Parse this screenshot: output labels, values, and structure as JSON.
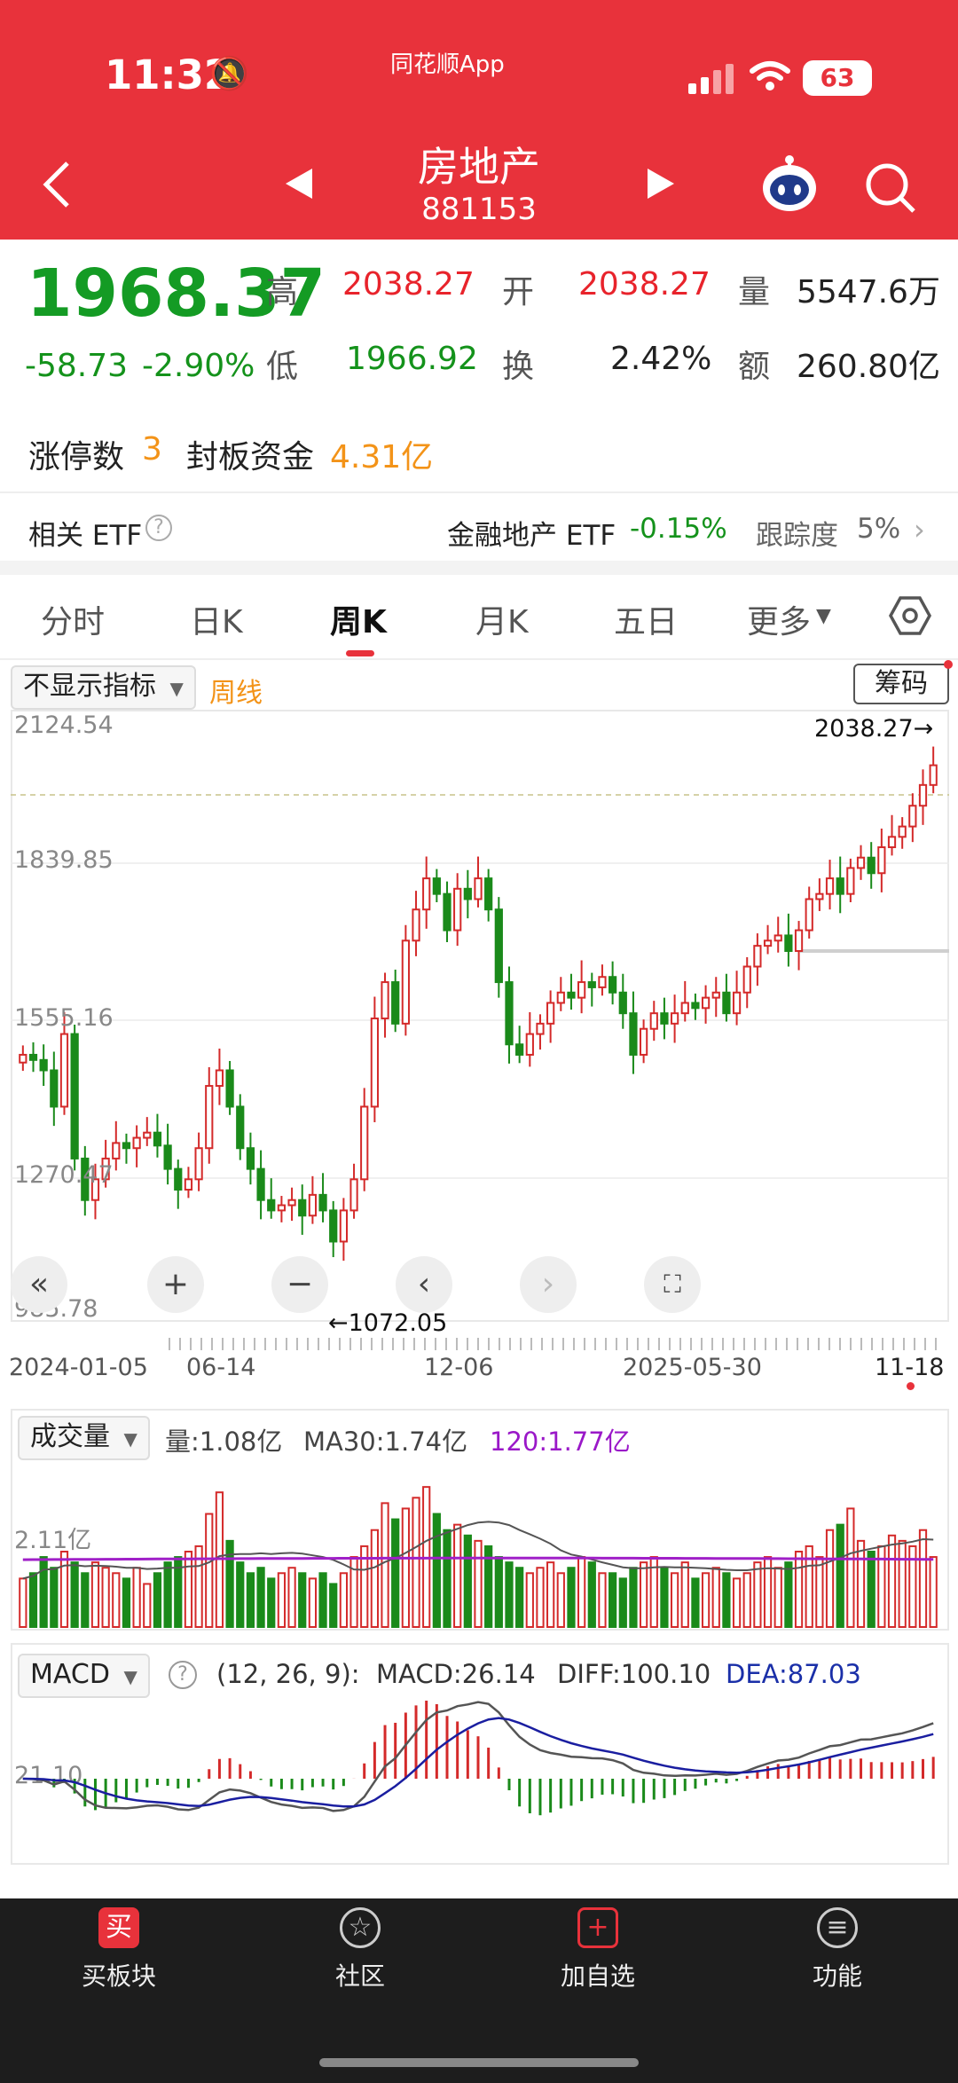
{
  "status": {
    "time": "11:32",
    "app_name": "同花顺App",
    "battery": "63"
  },
  "nav": {
    "title": "房地产",
    "code": "881153"
  },
  "quote": {
    "price": "1968.37",
    "change": "-58.73",
    "change_pct": "-2.90%",
    "high_label": "高",
    "high": "2038.27",
    "open_label": "开",
    "open": "2038.27",
    "volume_label": "量",
    "volume": "5547.6万",
    "low_label": "低",
    "low": "1966.92",
    "turnover_label": "换",
    "turnover": "2.42%",
    "amount_label": "额",
    "amount": "260.80亿"
  },
  "limit": {
    "count_label": "涨停数",
    "count": "3",
    "seal_label": "封板资金",
    "seal_value": "4.31亿"
  },
  "etf": {
    "label": "相关 ETF",
    "name": "金融地产 ETF",
    "change": "-0.15%",
    "tracking_label": "跟踪度",
    "tracking": "5%"
  },
  "tabs": [
    "分时",
    "日K",
    "周K",
    "月K",
    "五日",
    "更多"
  ],
  "kline": {
    "indicator": "不显示指标",
    "period": "周线",
    "chips_label": "筹码"
  },
  "chart_data": {
    "type": "candlestick",
    "y_ticks": [
      "2124.54",
      "1839.85",
      "1555.16",
      "1270.47",
      "985.78"
    ],
    "ylim": [
      985.78,
      2124.54
    ],
    "x_ticks": [
      "2024-01-05",
      "06-14",
      "12-06",
      "2025-05-30",
      "11-18"
    ],
    "max_marker": "2038.27→",
    "min_marker": "←1072.05",
    "closes": [
      1480,
      1470,
      1450,
      1380,
      1520,
      1280,
      1200,
      1240,
      1280,
      1310,
      1300,
      1320,
      1330,
      1305,
      1260,
      1220,
      1240,
      1300,
      1420,
      1450,
      1380,
      1300,
      1260,
      1200,
      1180,
      1190,
      1200,
      1170,
      1210,
      1180,
      1120,
      1180,
      1240,
      1380,
      1550,
      1620,
      1540,
      1700,
      1760,
      1820,
      1790,
      1720,
      1800,
      1780,
      1820,
      1760,
      1620,
      1500,
      1480,
      1520,
      1540,
      1580,
      1600,
      1590,
      1620,
      1610,
      1630,
      1600,
      1560,
      1480,
      1530,
      1560,
      1540,
      1560,
      1580,
      1570,
      1590,
      1600,
      1560,
      1600,
      1650,
      1690,
      1700,
      1710,
      1680,
      1720,
      1780,
      1790,
      1820,
      1790,
      1840,
      1860,
      1830,
      1880,
      1900,
      1920,
      1960,
      2000,
      2038
    ],
    "volumes": [
      0.9,
      1.0,
      1.3,
      1.1,
      1.4,
      1.2,
      1.0,
      1.2,
      1.1,
      1.0,
      0.9,
      1.1,
      0.8,
      1.0,
      1.2,
      1.3,
      1.4,
      1.5,
      2.1,
      2.5,
      1.6,
      1.2,
      1.0,
      1.1,
      0.9,
      1.0,
      1.1,
      1.0,
      0.9,
      1.0,
      0.8,
      1.0,
      1.3,
      1.5,
      1.8,
      2.3,
      2.0,
      2.2,
      2.4,
      2.6,
      2.1,
      1.8,
      1.9,
      1.7,
      1.6,
      1.5,
      1.3,
      1.2,
      1.1,
      1.0,
      1.1,
      1.2,
      1.0,
      1.1,
      1.3,
      1.2,
      1.0,
      1.0,
      0.9,
      1.1,
      1.2,
      1.3,
      1.1,
      1.0,
      1.2,
      0.9,
      1.0,
      1.1,
      1.0,
      0.9,
      1.0,
      1.2,
      1.3,
      1.1,
      1.2,
      1.4,
      1.5,
      1.3,
      1.8,
      1.9,
      2.2,
      1.6,
      1.4,
      1.5,
      1.7,
      1.6,
      1.5,
      1.8,
      1.3
    ]
  },
  "volume_panel": {
    "label": "成交量",
    "vol": "量:1.08亿",
    "ma30": "MA30:1.74亿",
    "ma120": "120:1.77亿",
    "axis": "2.11亿"
  },
  "macd_panel": {
    "label": "MACD",
    "params": "(12, 26, 9):",
    "macd": "MACD:26.14",
    "diff": "DIFF:100.10",
    "dea": "DEA:87.03",
    "axis": "21.10"
  },
  "bottom": {
    "buy_icon": "买",
    "items": [
      "买板块",
      "社区",
      "加自选",
      "功能"
    ]
  }
}
